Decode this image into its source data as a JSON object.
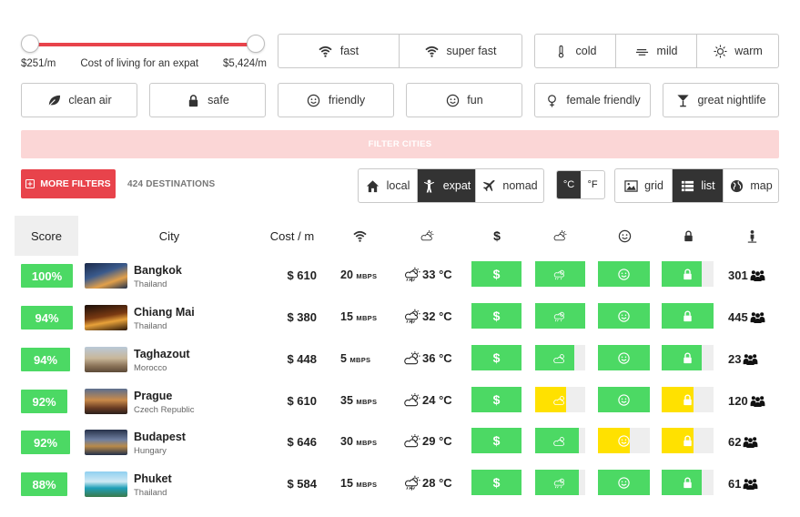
{
  "slider": {
    "min_label": "$251/m",
    "center_label": "Cost of living for an expat",
    "max_label": "$5,424/m"
  },
  "internet": {
    "fast": "fast",
    "super_fast": "super fast"
  },
  "temperature": {
    "cold": "cold",
    "mild": "mild",
    "warm": "warm"
  },
  "tags": {
    "clean_air": "clean air",
    "safe": "safe",
    "friendly": "friendly",
    "fun": "fun",
    "female_friendly": "female friendly",
    "great_nightlife": "great nightlife"
  },
  "filter_bar": "FILTER CITIES",
  "more_filters": "MORE FILTERS",
  "destinations": "424 DESTINATIONS",
  "mode": {
    "local": "local",
    "expat": "expat",
    "nomad": "nomad",
    "active": "expat"
  },
  "units": {
    "c": "°C",
    "f": "°F",
    "active": "c"
  },
  "view": {
    "grid": "grid",
    "list": "list",
    "map": "map",
    "active": "list"
  },
  "table": {
    "headers": {
      "score": "Score",
      "city": "City",
      "cost": "Cost / m"
    },
    "rows": [
      {
        "score": "100%",
        "city": "Bangkok",
        "country": "Thailand",
        "cost": "$ 610",
        "speed": "20",
        "speed_unit": "MBPS",
        "temp": "33 °C",
        "weather": "storm",
        "cost_level": 1.0,
        "climate_level": 1.0,
        "climate_color": "#4cd964",
        "friendly_level": 1.0,
        "friendly_color": "#4cd964",
        "safe_level": 0.78,
        "safe_color": "#4cd964",
        "population": "301"
      },
      {
        "score": "94%",
        "city": "Chiang Mai",
        "country": "Thailand",
        "cost": "$ 380",
        "speed": "15",
        "speed_unit": "MBPS",
        "temp": "32 °C",
        "weather": "storm",
        "cost_level": 1.0,
        "climate_level": 1.0,
        "climate_color": "#4cd964",
        "friendly_level": 1.0,
        "friendly_color": "#4cd964",
        "safe_level": 1.0,
        "safe_color": "#4cd964",
        "population": "445"
      },
      {
        "score": "94%",
        "city": "Taghazout",
        "country": "Morocco",
        "cost": "$ 448",
        "speed": "5",
        "speed_unit": "MBPS",
        "temp": "36 °C",
        "weather": "sun-cloud",
        "cost_level": 1.0,
        "climate_level": 0.78,
        "climate_color": "#4cd964",
        "friendly_level": 1.0,
        "friendly_color": "#4cd964",
        "safe_level": 0.78,
        "safe_color": "#4cd964",
        "population": "23"
      },
      {
        "score": "92%",
        "city": "Prague",
        "country": "Czech Republic",
        "cost": "$ 610",
        "speed": "35",
        "speed_unit": "MBPS",
        "temp": "24 °C",
        "weather": "sun-cloud",
        "cost_level": 1.0,
        "climate_level": 0.62,
        "climate_color": "#ffe100",
        "friendly_level": 1.0,
        "friendly_color": "#4cd964",
        "safe_level": 0.62,
        "safe_color": "#ffe100",
        "population": "120"
      },
      {
        "score": "92%",
        "city": "Budapest",
        "country": "Hungary",
        "cost": "$ 646",
        "speed": "30",
        "speed_unit": "MBPS",
        "temp": "29 °C",
        "weather": "sun-cloud",
        "cost_level": 1.0,
        "climate_level": 0.88,
        "climate_color": "#4cd964",
        "friendly_level": 0.62,
        "friendly_color": "#ffe100",
        "safe_level": 0.62,
        "safe_color": "#ffe100",
        "population": "62"
      },
      {
        "score": "88%",
        "city": "Phuket",
        "country": "Thailand",
        "cost": "$ 584",
        "speed": "15",
        "speed_unit": "MBPS",
        "temp": "28 °C",
        "weather": "storm",
        "cost_level": 1.0,
        "climate_level": 0.88,
        "climate_color": "#4cd964",
        "friendly_level": 1.0,
        "friendly_color": "#4cd964",
        "safe_level": 0.78,
        "safe_color": "#4cd964",
        "population": "61"
      }
    ]
  },
  "colors": {
    "accent": "#e8434b",
    "good": "#4cd964",
    "ok": "#ffe100",
    "filter_bar": "#fbd6d6"
  }
}
